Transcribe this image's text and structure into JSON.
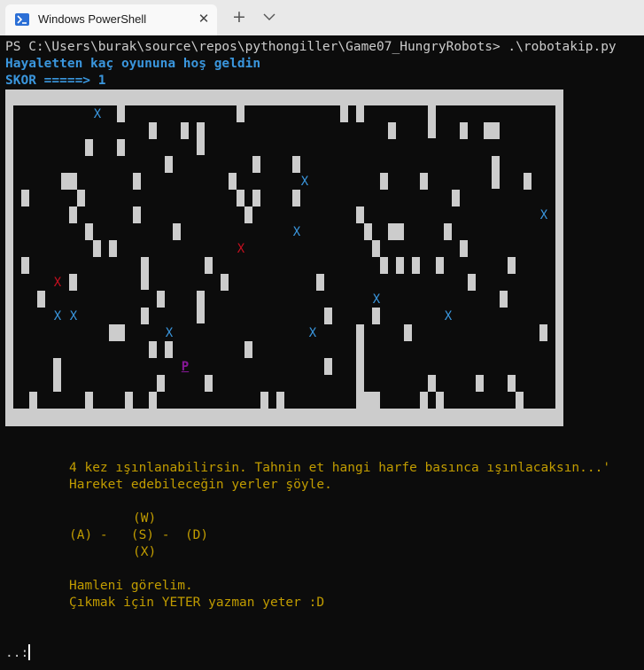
{
  "window": {
    "tab_title": "Windows PowerShell",
    "close_glyph": "✕",
    "new_tab_glyph": "+",
    "tab_icon": "powershell-icon",
    "dropdown_icon": "chevron-down-icon"
  },
  "terminal": {
    "prompt_line": "PS C:\\Users\\burak\\source\\repos\\pythongiller\\Game07_HungryRobots> .\\robotakip.py",
    "welcome": "Hayaletten kaç oyununa hoş geldin",
    "score": "SKOR =====> 1",
    "teleport_msg": "4 kez ışınlanabilirsin. Tahnin et hangi harfe basınca ışınlacaksın...'",
    "moves_msg": "Hareket edebileceğin yerler şöyle.",
    "key_w": "(W)",
    "key_row": "(A) -   (S) -  (D)",
    "key_x": "(X)",
    "lets_see": "Hamleni görelim.",
    "exit_msg": "Çıkmak için YETER yazman yeter :D",
    "input_prompt": "..:",
    "input_value": ""
  },
  "board": {
    "ghost_glyph": "X",
    "robot_glyph": "X",
    "player_glyph": "P",
    "colors": {
      "wall": "#cccccc",
      "ghost": "#3a96dd",
      "robot": "#c50f1f",
      "player": "#881798",
      "text": "#c19c00"
    }
  }
}
